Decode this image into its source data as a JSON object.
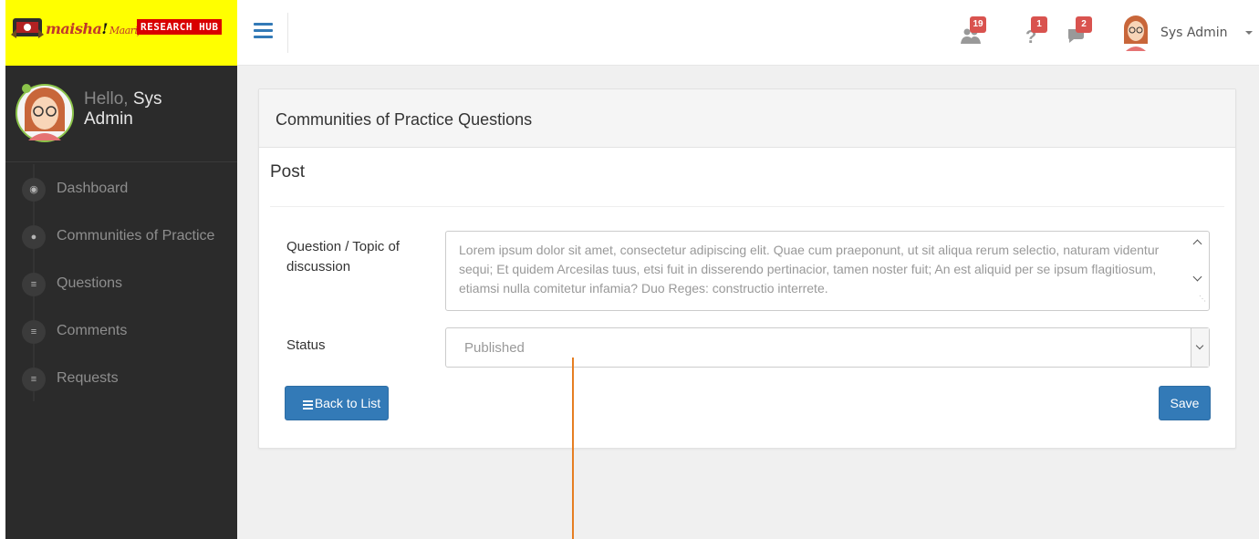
{
  "brand": {
    "logo_text": "mai",
    "logo_text2": "sha",
    "logo_excl": "!",
    "logo_sub": "Maarifa",
    "badge": "RESEARCH HUB",
    "bg_color": "#ffff00"
  },
  "header": {
    "notifications": [
      {
        "icon": "users-icon",
        "count": "19"
      },
      {
        "icon": "question-icon",
        "count": "1"
      },
      {
        "icon": "comments-icon",
        "count": "2"
      }
    ],
    "user_name": "Sys Admin"
  },
  "sidebar": {
    "hello": "Hello,",
    "name_first": "Sys",
    "name_last": "Admin",
    "items": [
      {
        "label": "Dashboard",
        "icon": "dashboard-icon"
      },
      {
        "label": "Communities of Practice",
        "icon": "group-icon"
      },
      {
        "label": "Questions",
        "icon": "list-icon"
      },
      {
        "label": "Comments",
        "icon": "list-icon"
      },
      {
        "label": "Requests",
        "icon": "list-icon"
      }
    ]
  },
  "panel": {
    "title": "Communities of Practice Questions",
    "section": "Post",
    "question_label": "Question / Topic of discussion",
    "question_value": "Lorem ipsum dolor sit amet, consectetur adipiscing elit. Quae cum praeponunt, ut sit aliqua rerum selectio, naturam videntur sequi; Et quidem Arcesilas tuus, etsi fuit in disserendo pertinacior, tamen noster fuit; An est aliquid per se ipsum flagitiosum, etiamsi nulla comitetur infamia? Duo Reges: constructio interrete.",
    "status_label": "Status",
    "status_value": "Published",
    "back_button": "Back to List",
    "save_button": "Save"
  },
  "colors": {
    "primary": "#337ab7",
    "sidebar_bg": "#2b2b2b",
    "badge_red": "#d9534f",
    "annotation": "#e67e22"
  }
}
